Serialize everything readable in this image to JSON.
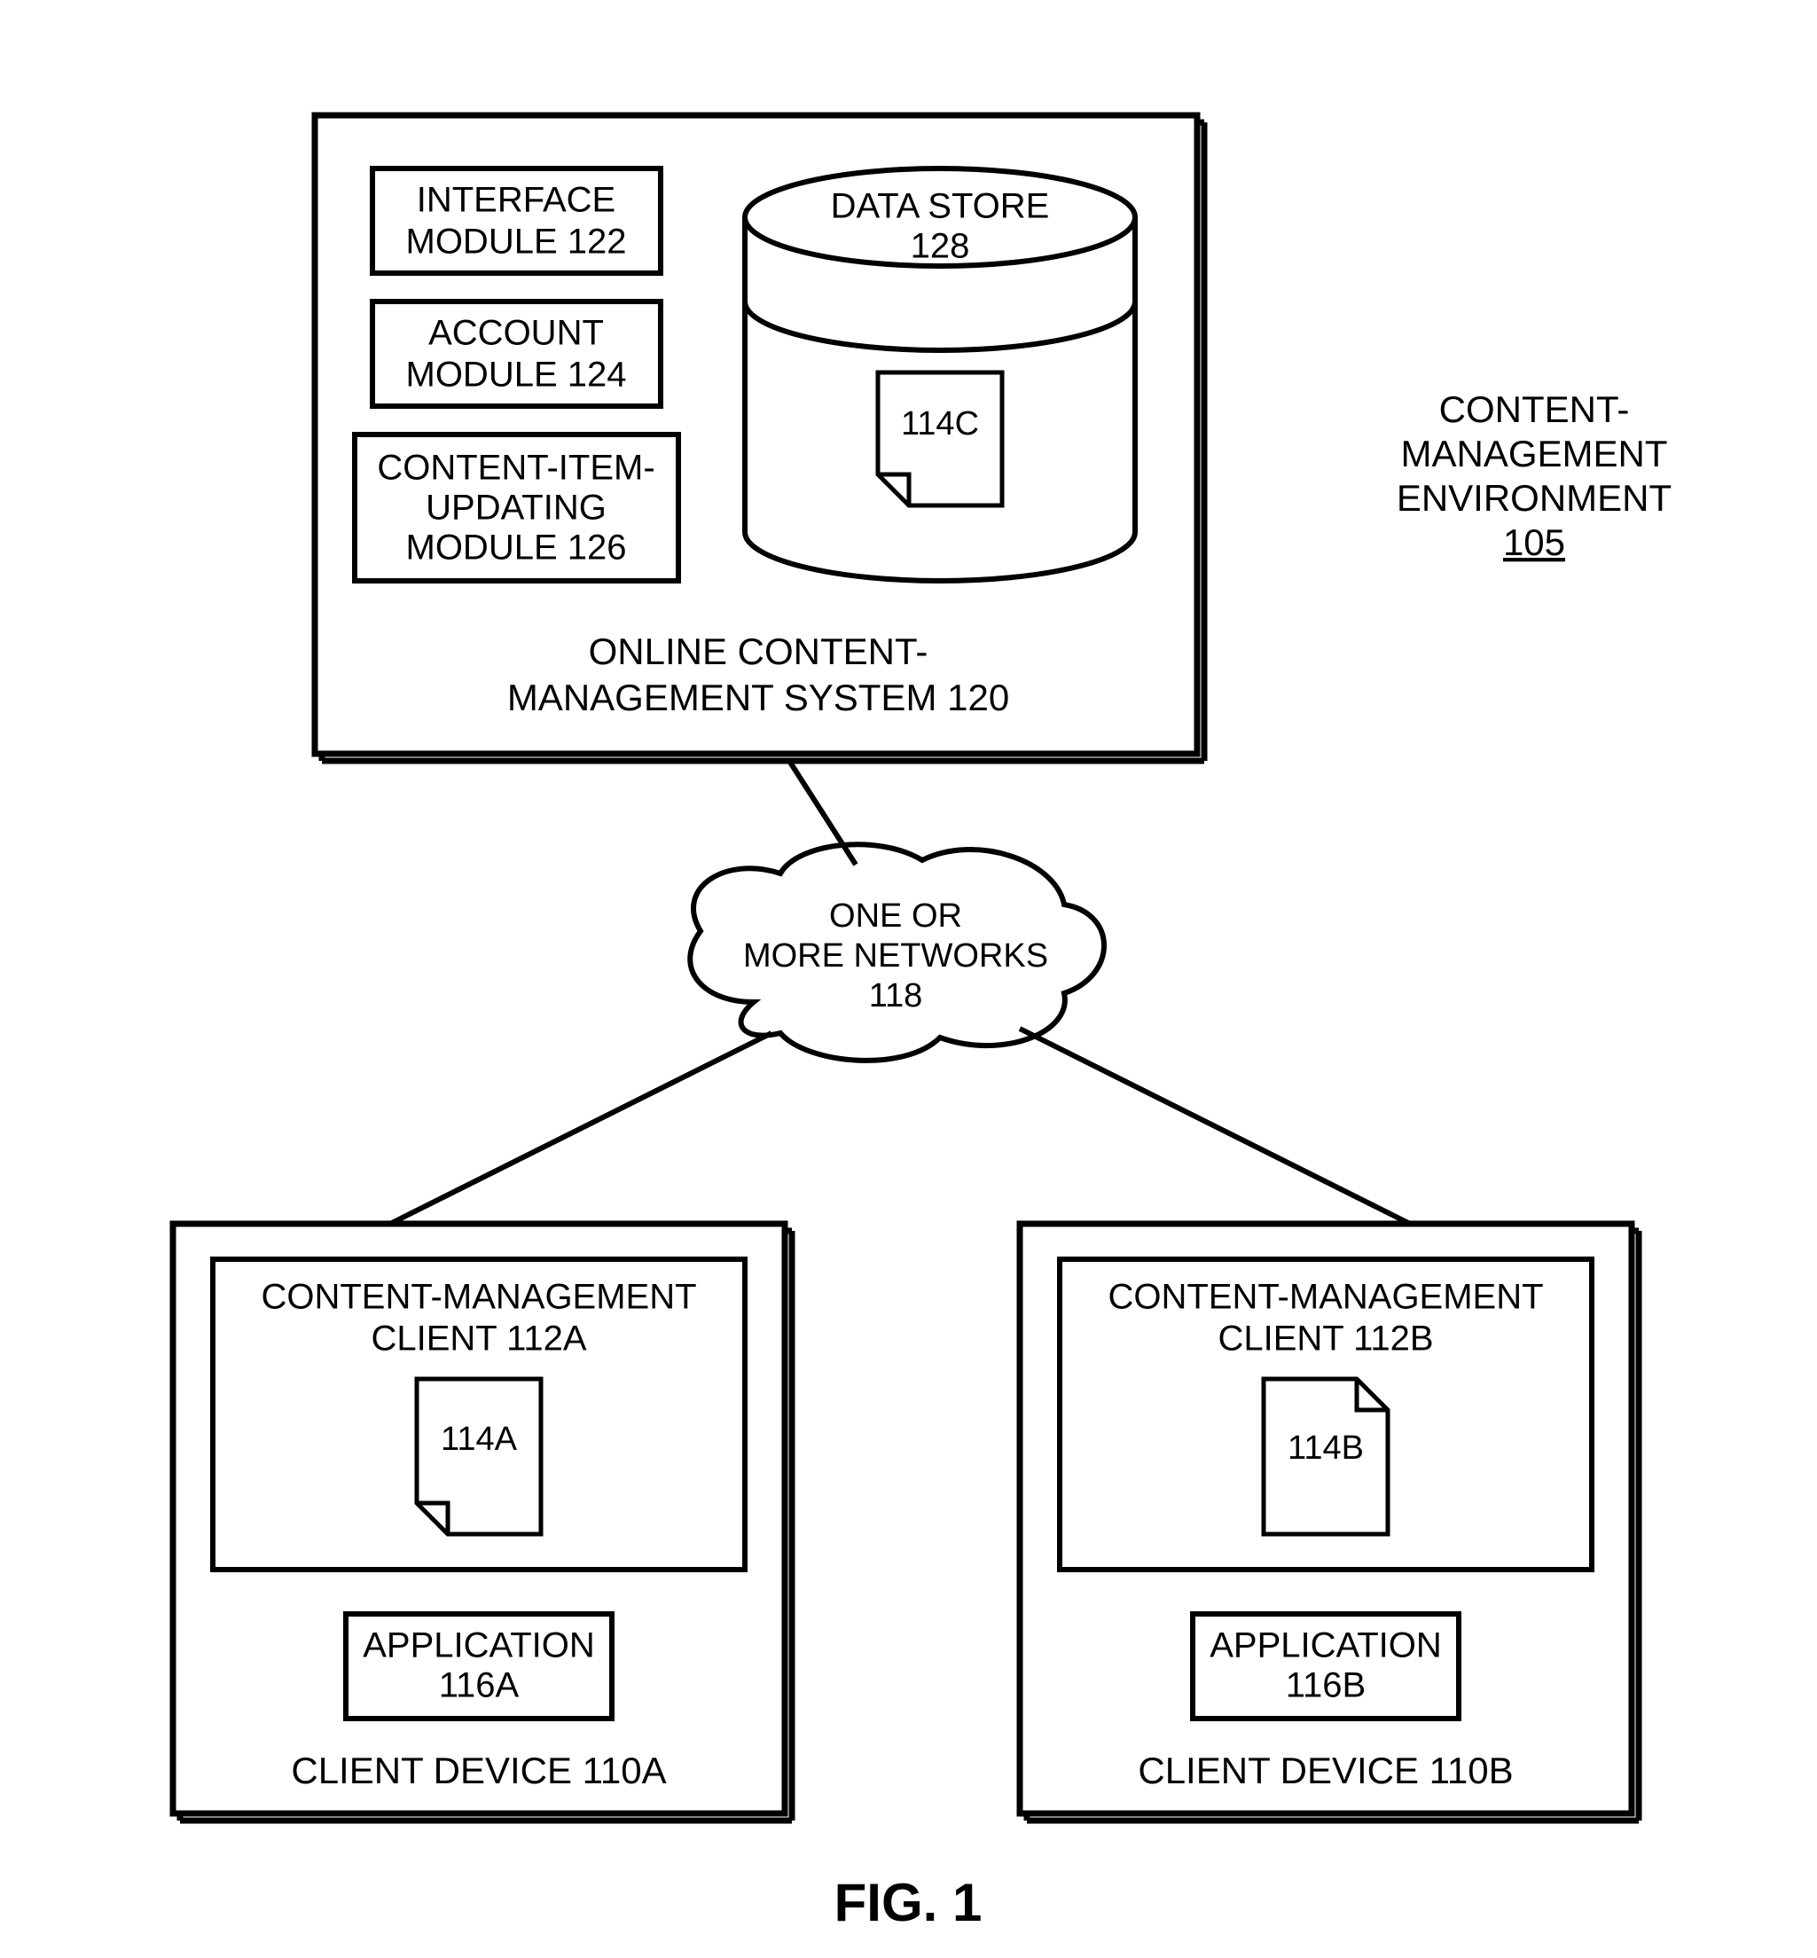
{
  "sideLabel": {
    "l1": "CONTENT-",
    "l2": "MANAGEMENT",
    "l3": "ENVIRONMENT",
    "num": "105"
  },
  "server": {
    "title_l1": "ONLINE CONTENT-",
    "title_l2": "MANAGEMENT SYSTEM 120",
    "mod1_l1": "INTERFACE",
    "mod1_l2": "MODULE 122",
    "mod2_l1": "ACCOUNT",
    "mod2_l2": "MODULE 124",
    "mod3_l1": "CONTENT-ITEM-",
    "mod3_l2": "UPDATING",
    "mod3_l3": "MODULE 126",
    "ds_l1": "DATA STORE",
    "ds_l2": "128",
    "file": "114C"
  },
  "cloud": {
    "l1": "ONE OR",
    "l2": "MORE NETWORKS",
    "l3": "118"
  },
  "clientA": {
    "cm_l1": "CONTENT-MANAGEMENT",
    "cm_l2": "CLIENT 112A",
    "file": "114A",
    "app_l1": "APPLICATION",
    "app_l2": "116A",
    "device": "CLIENT DEVICE 110A"
  },
  "clientB": {
    "cm_l1": "CONTENT-MANAGEMENT",
    "cm_l2": "CLIENT 112B",
    "file": "114B",
    "app_l1": "APPLICATION",
    "app_l2": "116B",
    "device": "CLIENT DEVICE 110B"
  },
  "figure": "FIG. 1"
}
